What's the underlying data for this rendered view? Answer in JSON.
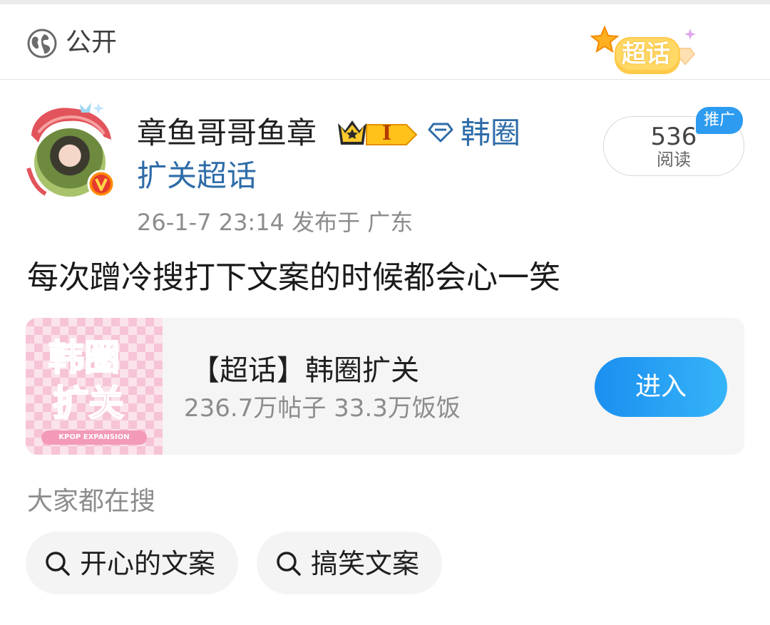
{
  "header": {
    "visibility_label": "公开",
    "badge_text": "超话"
  },
  "post": {
    "username": "章鱼哥哥鱼章",
    "level_badge": "I",
    "group_line1": "韩圈",
    "group_line2": "扩关超话",
    "reads_count": "536",
    "reads_label": "阅读",
    "promo_tag": "推广",
    "timestamp": "26-1-7 23:14  发布于 广东",
    "content": "每次蹭冷搜打下文案的时候都会心一笑"
  },
  "topic_card": {
    "thumb_text_top": "韩圈",
    "thumb_text_bottom": "扩关",
    "thumb_caption": "KPOP EXPANSION",
    "title": "【超话】韩圈扩关",
    "stats": "236.7万帖子 33.3万饭饭",
    "enter_label": "进入"
  },
  "search": {
    "heading": "大家都在搜",
    "chips": [
      "开心的文案",
      "搞笑文案"
    ]
  },
  "colors": {
    "link_blue": "#2e6ca8",
    "accent_blue": "#2d9cf0",
    "muted_gray": "#8c8c8c"
  }
}
